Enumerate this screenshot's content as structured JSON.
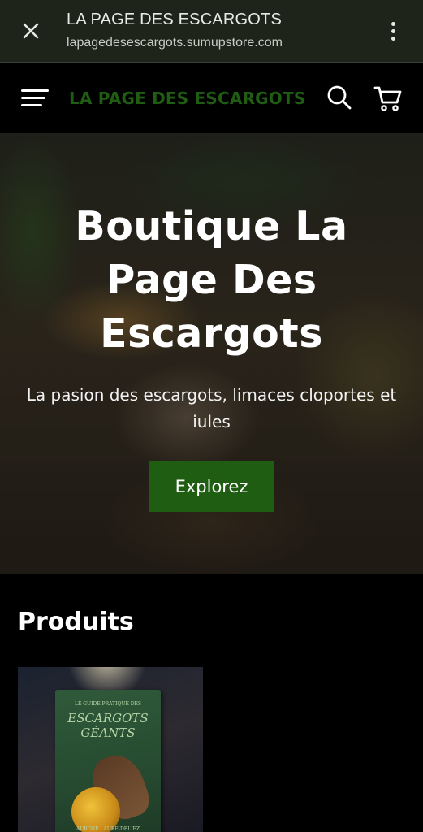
{
  "browser": {
    "title": "LA PAGE DES ESCARGOTS",
    "url": "lapagedesescargots.sumupstore.com",
    "close_icon": "close-icon",
    "menu_icon": "more-vert-icon"
  },
  "header": {
    "logo_text": "LA PAGE DES ESCARGOTS",
    "menu_icon": "hamburger-icon",
    "search_icon": "search-icon",
    "cart_icon": "cart-icon",
    "brand_color": "#1f5e12"
  },
  "hero": {
    "title": "Boutique La Page Des Escargots",
    "subtitle": "La pasion des escargots, limaces cloportes et iules",
    "button_label": "Explorez",
    "button_color": "#1f5e12"
  },
  "products": {
    "heading": "Produits",
    "items": [
      {
        "book_top_line": "LE GUIDE PRATIQUE DES",
        "book_title_1": "ESCARGOTS",
        "book_title_2": "GÉANTS",
        "book_author": "AURORE LAURE-DELIEZ"
      }
    ]
  }
}
